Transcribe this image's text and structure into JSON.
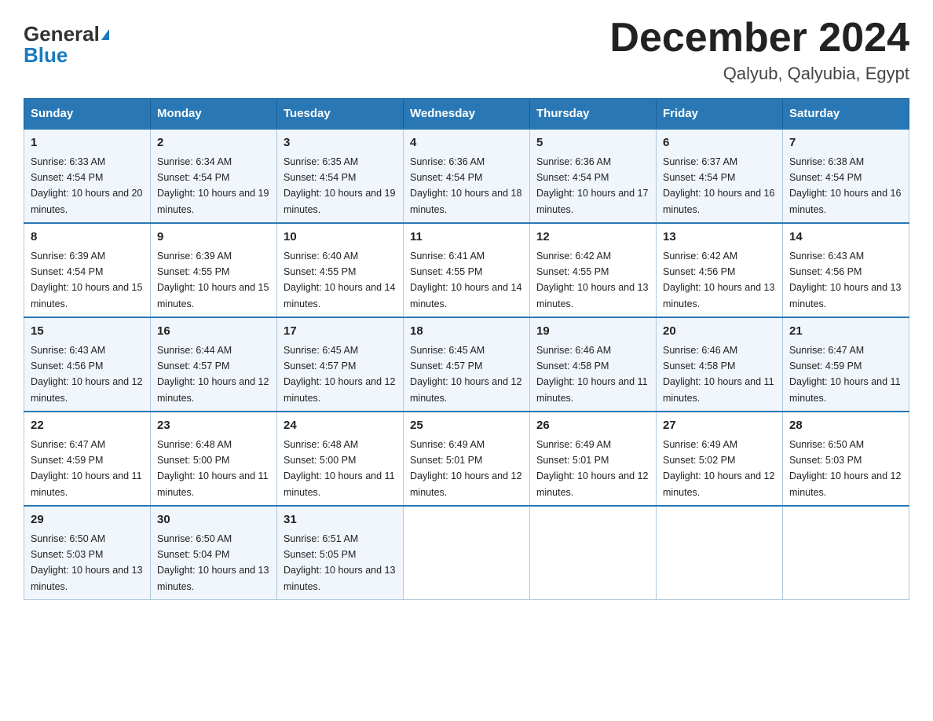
{
  "header": {
    "logo_general": "General",
    "logo_blue": "Blue",
    "month_title": "December 2024",
    "location": "Qalyub, Qalyubia, Egypt"
  },
  "days_of_week": [
    "Sunday",
    "Monday",
    "Tuesday",
    "Wednesday",
    "Thursday",
    "Friday",
    "Saturday"
  ],
  "weeks": [
    [
      {
        "day": "1",
        "sunrise": "6:33 AM",
        "sunset": "4:54 PM",
        "daylight": "10 hours and 20 minutes."
      },
      {
        "day": "2",
        "sunrise": "6:34 AM",
        "sunset": "4:54 PM",
        "daylight": "10 hours and 19 minutes."
      },
      {
        "day": "3",
        "sunrise": "6:35 AM",
        "sunset": "4:54 PM",
        "daylight": "10 hours and 19 minutes."
      },
      {
        "day": "4",
        "sunrise": "6:36 AM",
        "sunset": "4:54 PM",
        "daylight": "10 hours and 18 minutes."
      },
      {
        "day": "5",
        "sunrise": "6:36 AM",
        "sunset": "4:54 PM",
        "daylight": "10 hours and 17 minutes."
      },
      {
        "day": "6",
        "sunrise": "6:37 AM",
        "sunset": "4:54 PM",
        "daylight": "10 hours and 16 minutes."
      },
      {
        "day": "7",
        "sunrise": "6:38 AM",
        "sunset": "4:54 PM",
        "daylight": "10 hours and 16 minutes."
      }
    ],
    [
      {
        "day": "8",
        "sunrise": "6:39 AM",
        "sunset": "4:54 PM",
        "daylight": "10 hours and 15 minutes."
      },
      {
        "day": "9",
        "sunrise": "6:39 AM",
        "sunset": "4:55 PM",
        "daylight": "10 hours and 15 minutes."
      },
      {
        "day": "10",
        "sunrise": "6:40 AM",
        "sunset": "4:55 PM",
        "daylight": "10 hours and 14 minutes."
      },
      {
        "day": "11",
        "sunrise": "6:41 AM",
        "sunset": "4:55 PM",
        "daylight": "10 hours and 14 minutes."
      },
      {
        "day": "12",
        "sunrise": "6:42 AM",
        "sunset": "4:55 PM",
        "daylight": "10 hours and 13 minutes."
      },
      {
        "day": "13",
        "sunrise": "6:42 AM",
        "sunset": "4:56 PM",
        "daylight": "10 hours and 13 minutes."
      },
      {
        "day": "14",
        "sunrise": "6:43 AM",
        "sunset": "4:56 PM",
        "daylight": "10 hours and 13 minutes."
      }
    ],
    [
      {
        "day": "15",
        "sunrise": "6:43 AM",
        "sunset": "4:56 PM",
        "daylight": "10 hours and 12 minutes."
      },
      {
        "day": "16",
        "sunrise": "6:44 AM",
        "sunset": "4:57 PM",
        "daylight": "10 hours and 12 minutes."
      },
      {
        "day": "17",
        "sunrise": "6:45 AM",
        "sunset": "4:57 PM",
        "daylight": "10 hours and 12 minutes."
      },
      {
        "day": "18",
        "sunrise": "6:45 AM",
        "sunset": "4:57 PM",
        "daylight": "10 hours and 12 minutes."
      },
      {
        "day": "19",
        "sunrise": "6:46 AM",
        "sunset": "4:58 PM",
        "daylight": "10 hours and 11 minutes."
      },
      {
        "day": "20",
        "sunrise": "6:46 AM",
        "sunset": "4:58 PM",
        "daylight": "10 hours and 11 minutes."
      },
      {
        "day": "21",
        "sunrise": "6:47 AM",
        "sunset": "4:59 PM",
        "daylight": "10 hours and 11 minutes."
      }
    ],
    [
      {
        "day": "22",
        "sunrise": "6:47 AM",
        "sunset": "4:59 PM",
        "daylight": "10 hours and 11 minutes."
      },
      {
        "day": "23",
        "sunrise": "6:48 AM",
        "sunset": "5:00 PM",
        "daylight": "10 hours and 11 minutes."
      },
      {
        "day": "24",
        "sunrise": "6:48 AM",
        "sunset": "5:00 PM",
        "daylight": "10 hours and 11 minutes."
      },
      {
        "day": "25",
        "sunrise": "6:49 AM",
        "sunset": "5:01 PM",
        "daylight": "10 hours and 12 minutes."
      },
      {
        "day": "26",
        "sunrise": "6:49 AM",
        "sunset": "5:01 PM",
        "daylight": "10 hours and 12 minutes."
      },
      {
        "day": "27",
        "sunrise": "6:49 AM",
        "sunset": "5:02 PM",
        "daylight": "10 hours and 12 minutes."
      },
      {
        "day": "28",
        "sunrise": "6:50 AM",
        "sunset": "5:03 PM",
        "daylight": "10 hours and 12 minutes."
      }
    ],
    [
      {
        "day": "29",
        "sunrise": "6:50 AM",
        "sunset": "5:03 PM",
        "daylight": "10 hours and 13 minutes."
      },
      {
        "day": "30",
        "sunrise": "6:50 AM",
        "sunset": "5:04 PM",
        "daylight": "10 hours and 13 minutes."
      },
      {
        "day": "31",
        "sunrise": "6:51 AM",
        "sunset": "5:05 PM",
        "daylight": "10 hours and 13 minutes."
      },
      null,
      null,
      null,
      null
    ]
  ]
}
